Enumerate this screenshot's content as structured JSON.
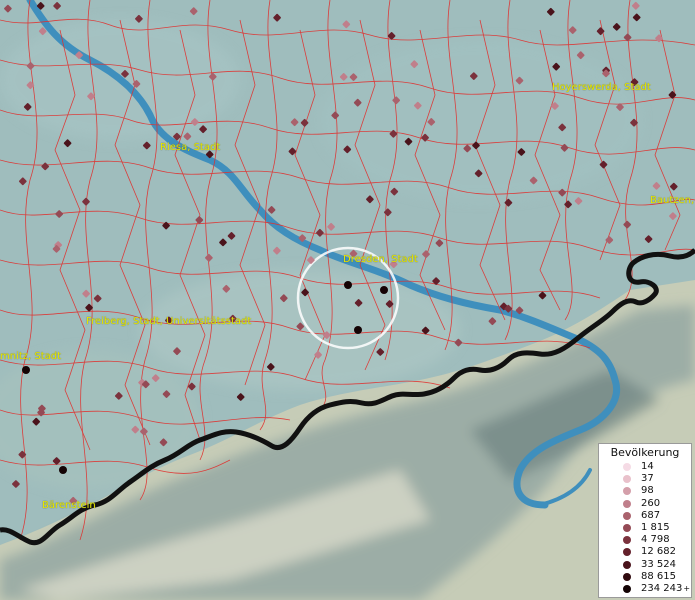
{
  "map": {
    "places": [
      {
        "id": "hoyerswerda",
        "label": "Hoyerswerda, Stadt"
      },
      {
        "id": "riesa",
        "label": "Riesa, Stadt"
      },
      {
        "id": "bautzen",
        "label": "Bautzen,"
      },
      {
        "id": "dresden",
        "label": "Dresden, Stadt"
      },
      {
        "id": "freiberg",
        "label": "Freiberg, Stadt, Universitätsstadt"
      },
      {
        "id": "chemnitz",
        "label": "mnitz, Stadt"
      },
      {
        "id": "baerenstein",
        "label": "Bärenstein"
      }
    ],
    "colors": {
      "background": "#9fbdbd",
      "river": "#3f8fbd",
      "boundary": "#e0302e",
      "state_border": "#111111",
      "mountains": "#c9cdb5",
      "label": "#e8e800"
    }
  },
  "legend": {
    "title": "Bevölkerung",
    "classes": [
      {
        "label": "14",
        "color": "#f5dbe5"
      },
      {
        "label": "37",
        "color": "#e9c1cb"
      },
      {
        "label": "98",
        "color": "#d49faa"
      },
      {
        "label": "260",
        "color": "#c07f8b"
      },
      {
        "label": "687",
        "color": "#aa626d"
      },
      {
        "label": "1 815",
        "color": "#944a55"
      },
      {
        "label": "4 798",
        "color": "#7b323d"
      },
      {
        "label": "12 682",
        "color": "#64202b"
      },
      {
        "label": "33 524",
        "color": "#4a131b"
      },
      {
        "label": "88 615",
        "color": "#300a0e"
      },
      {
        "label": "234 243",
        "color": "#140304",
        "plus": "+"
      }
    ]
  }
}
